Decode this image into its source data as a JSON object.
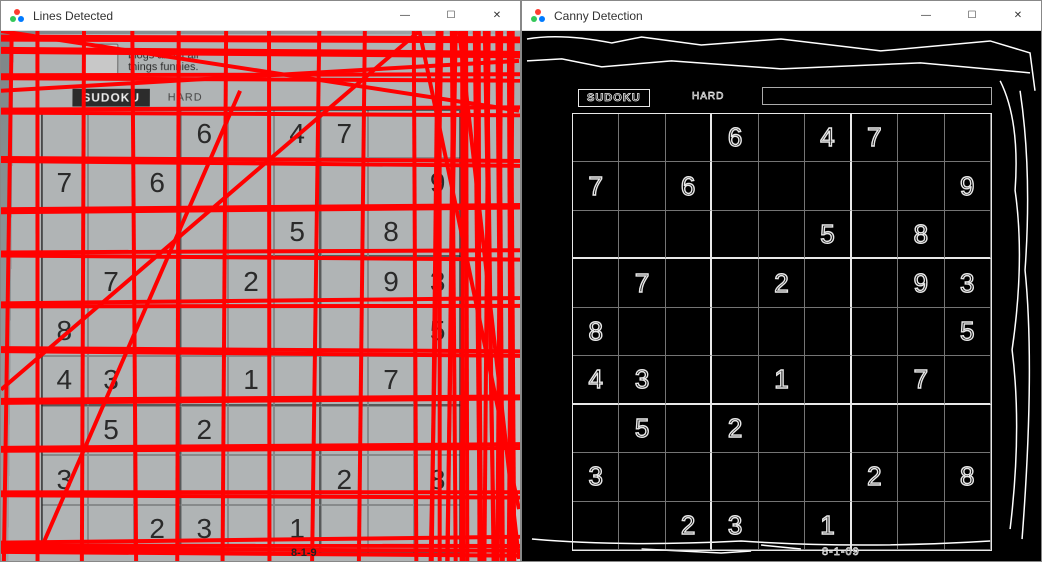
{
  "windows": {
    "left": {
      "title": "Lines Detected",
      "controls": {
        "min": "—",
        "max": "☐",
        "close": "✕"
      }
    },
    "right": {
      "title": "Canny Detection",
      "controls": {
        "min": "—",
        "max": "☐",
        "close": "✕"
      }
    }
  },
  "newspaper": {
    "blurb_line1": "blogs about all",
    "blurb_line2": "things funnies.",
    "puzzle_title": "SUDOKU",
    "difficulty": "HARD",
    "caption_fragment": "8-1-9",
    "caption_fragment_right": "8-1-09"
  },
  "sudoku": {
    "grid": [
      [
        "",
        "",
        "",
        "6",
        "",
        "4",
        "7",
        "",
        ""
      ],
      [
        "7",
        "",
        "6",
        "",
        "",
        "",
        "",
        "",
        "9"
      ],
      [
        "",
        "",
        "",
        "",
        "",
        "5",
        "",
        "8",
        ""
      ],
      [
        "",
        "7",
        "",
        "",
        "2",
        "",
        "",
        "9",
        "3"
      ],
      [
        "8",
        "",
        "",
        "",
        "",
        "",
        "",
        "",
        "5"
      ],
      [
        "4",
        "3",
        "",
        "",
        "1",
        "",
        "",
        "7",
        ""
      ],
      [
        "",
        "5",
        "",
        "2",
        "",
        "",
        "",
        "",
        ""
      ],
      [
        "3",
        "",
        "",
        "",
        "",
        "",
        "2",
        "",
        "8"
      ],
      [
        "",
        "",
        "2",
        "3",
        "",
        "1",
        "",
        "",
        ""
      ]
    ]
  }
}
